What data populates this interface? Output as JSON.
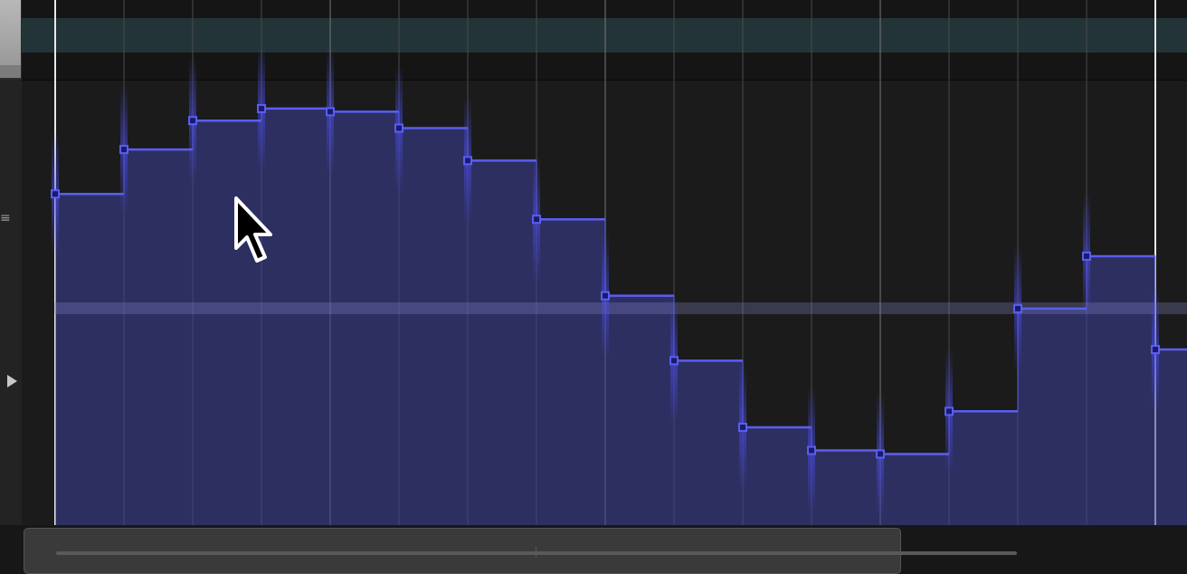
{
  "ui": {
    "lines_icon": "≡",
    "accent_color": "#5a5ef0",
    "point_fill": "#1b1b6a",
    "fill_color": "#3c3f9a"
  },
  "automation": {
    "levels": [
      0.745,
      0.845,
      0.91,
      0.937,
      0.93,
      0.893,
      0.82,
      0.688,
      0.516,
      0.37,
      0.22,
      0.168,
      0.16,
      0.256,
      0.487,
      0.605,
      0.395
    ]
  }
}
